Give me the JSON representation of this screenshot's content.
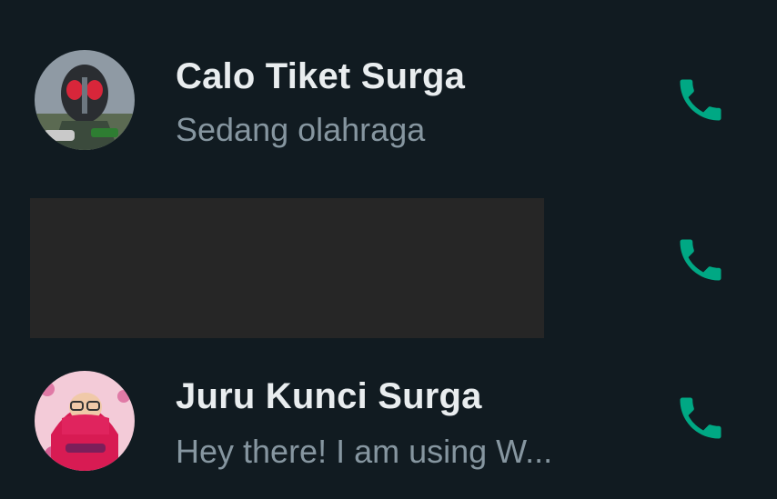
{
  "contacts": [
    {
      "name": "Calo Tiket Surga",
      "status": "Sedang olahraga"
    },
    {
      "name": "",
      "status": ""
    },
    {
      "name": "Juru Kunci Surga",
      "status": "Hey there! I am using W..."
    }
  ],
  "icons": {
    "call": "phone-icon"
  },
  "colors": {
    "background": "#111b21",
    "name_text": "#e9edef",
    "status_text": "#8696a0",
    "accent": "#00a884",
    "redaction": "#262626"
  }
}
